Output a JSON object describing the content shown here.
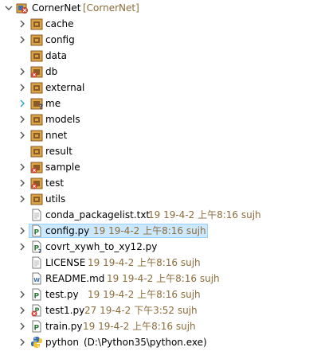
{
  "project": {
    "name": "CornerNet",
    "decoration": "[CornerNet]"
  },
  "folders": [
    {
      "label": "cache"
    },
    {
      "label": "config"
    },
    {
      "label": "data"
    },
    {
      "label": "db"
    },
    {
      "label": "external"
    },
    {
      "label": "me"
    },
    {
      "label": "models"
    },
    {
      "label": "nnet"
    },
    {
      "label": "result"
    },
    {
      "label": "sample"
    },
    {
      "label": "test"
    },
    {
      "label": "utils"
    }
  ],
  "files": [
    {
      "label": "conda_packagelist.txt",
      "info": "19  19-4-2 上午8:16  sujh"
    },
    {
      "label": "config.py",
      "info": "19  19-4-2 上午8:16  sujh"
    },
    {
      "label": "covrt_xywh_to_xy12.py",
      "info": ""
    },
    {
      "label": "LICENSE",
      "info": "19  19-4-2 上午8:16  sujh"
    },
    {
      "label": "README.md",
      "info": "19  19-4-2 上午8:16  sujh"
    },
    {
      "label": "test.py",
      "info": "19  19-4-2 上午8:16  sujh"
    },
    {
      "label": "test1.py",
      "info": "27  19-4-2 下午3:52  sujh"
    },
    {
      "label": "train.py",
      "info": "19  19-4-2 上午8:16  sujh"
    }
  ],
  "interpreter": {
    "label": "python",
    "path": "(D:\\Python35\\python.exe)"
  },
  "colors": {
    "folder": "#d9a441",
    "package_badge": "#8a5a2b",
    "error_badge": "#d23b2a",
    "selection": "#cce8ff",
    "decoration": "#8a6d3b"
  }
}
